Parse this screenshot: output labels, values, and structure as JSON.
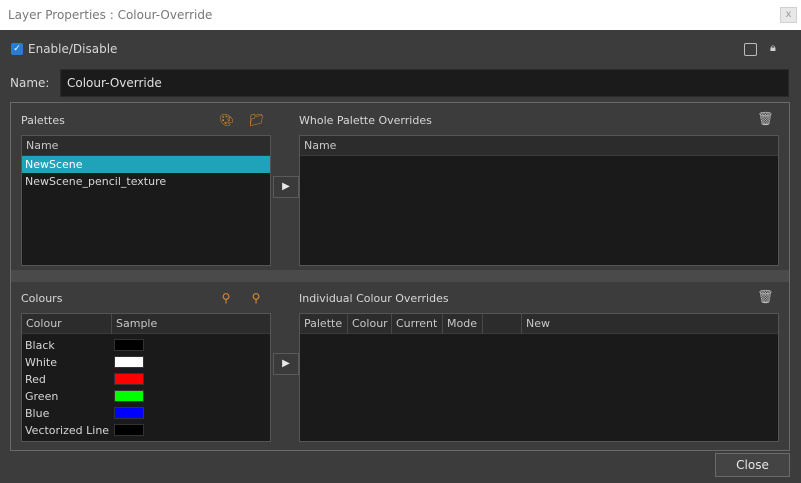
{
  "window": {
    "title": "Layer Properties : Colour-Override",
    "close_glyph": "x"
  },
  "enable": {
    "label": "Enable/Disable",
    "checked": true
  },
  "name_field": {
    "label": "Name:",
    "value": "Colour-Override"
  },
  "palettes": {
    "title": "Palettes",
    "column": "Name",
    "items": [
      {
        "label": "NewScene",
        "selected": true
      },
      {
        "label": "NewScene_pencil_texture",
        "selected": false
      }
    ]
  },
  "whole_overrides": {
    "title": "Whole Palette Overrides",
    "column": "Name"
  },
  "colours": {
    "title": "Colours",
    "columns": [
      "Colour",
      "Sample"
    ],
    "items": [
      {
        "name": "Black",
        "color": "#000000"
      },
      {
        "name": "White",
        "color": "#ffffff"
      },
      {
        "name": "Red",
        "color": "#ff0000"
      },
      {
        "name": "Green",
        "color": "#00ff00"
      },
      {
        "name": "Blue",
        "color": "#0000ff"
      },
      {
        "name": "Vectorized Line",
        "color": "#000000"
      }
    ]
  },
  "individual_overrides": {
    "title": "Individual Colour Overrides",
    "columns": [
      "Palette",
      "Colour",
      "Current",
      "Mode",
      "",
      "New"
    ]
  },
  "buttons": {
    "close": "Close",
    "arrow": "▶"
  },
  "accent": "#1ea3b8"
}
